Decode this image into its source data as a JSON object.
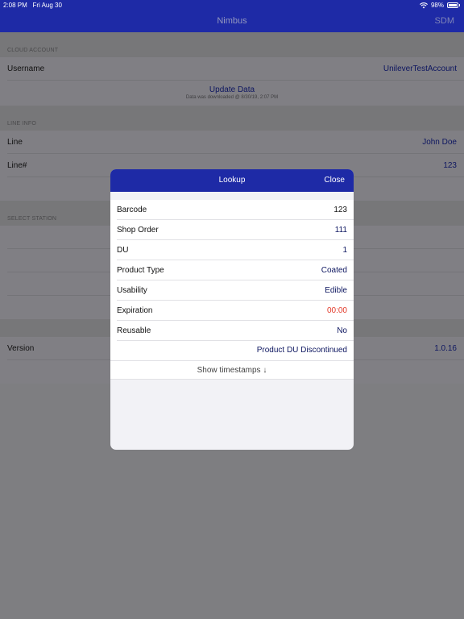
{
  "status_bar": {
    "time": "2:08 PM",
    "date": "Fri Aug 30",
    "battery": "98%"
  },
  "nav": {
    "title": "Nimbus",
    "right_button": "SDM"
  },
  "cloud_account": {
    "header": "CLOUD ACCOUNT",
    "username_label": "Username",
    "username_value": "UnileverTestAccount",
    "update_title": "Update Data",
    "update_subtitle": "Data was downloaded @ 8/30/19, 2:07 PM"
  },
  "line_info": {
    "header": "LINE INFO",
    "line_label": "Line",
    "line_value": "John Doe",
    "line_num_label": "Line#",
    "line_num_value": "123"
  },
  "select_station": {
    "header": "SELECT STATION"
  },
  "version": {
    "label": "Version",
    "value": "1.0.16"
  },
  "modal": {
    "title": "Lookup",
    "close_label": "Close",
    "rows": [
      {
        "label": "Barcode",
        "value": "123"
      },
      {
        "label": "Shop Order",
        "value": "111"
      },
      {
        "label": "DU",
        "value": "1"
      },
      {
        "label": "Product Type",
        "value": "Coated"
      },
      {
        "label": "Usability",
        "value": "Edible"
      },
      {
        "label": "Expiration",
        "value": "00:00"
      },
      {
        "label": "Reusable",
        "value": "No"
      }
    ],
    "status_text": "Product DU Discontinued",
    "show_timestamps": "Show timestamps ↓"
  },
  "colors": {
    "nav_blue": "#1e2aa6",
    "value_blue": "#0d1660",
    "expiration_red": "#e23a2a"
  },
  "icons": [
    "wifi-icon",
    "battery-icon",
    "arrow-down-icon"
  ]
}
